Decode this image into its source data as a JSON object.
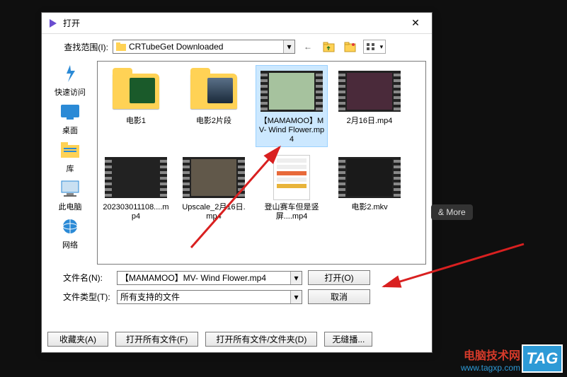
{
  "dialog": {
    "title": "打开",
    "lookup_label": "查找范围(I):",
    "lookup_value": "CRTubeGet Downloaded",
    "close_symbol": "✕"
  },
  "toolbar_icons": {
    "back": "←",
    "up": "folder-up",
    "new": "folder-new",
    "view": "view-menu",
    "view_arrow": "▾"
  },
  "places": [
    {
      "key": "quick",
      "label": "快速访问"
    },
    {
      "key": "desktop",
      "label": "桌面"
    },
    {
      "key": "library",
      "label": "库"
    },
    {
      "key": "pc",
      "label": "此电脑"
    },
    {
      "key": "network",
      "label": "网络"
    }
  ],
  "files": [
    {
      "type": "folder",
      "name": "电影1",
      "inset": "green"
    },
    {
      "type": "folder",
      "name": "电影2片段",
      "inset": "landscape"
    },
    {
      "type": "video",
      "name": "【MAMAMOO】MV- Wind Flower.mp4",
      "selected": true,
      "tint": "#a6c29e"
    },
    {
      "type": "video",
      "name": "2月16日.mp4",
      "tint": "#4a2a3a"
    },
    {
      "type": "video",
      "name": "202303011108....mp4",
      "tint": "#222"
    },
    {
      "type": "video",
      "name": "Upscale_2月16日.mp4",
      "tint": "#61584a"
    },
    {
      "type": "app",
      "name": "登山赛车但是竖屏....mp4"
    },
    {
      "type": "video",
      "name": "电影2.mkv",
      "tint": "#1a1a1a"
    }
  ],
  "bottom": {
    "name_label": "文件名(N):",
    "name_value": "【MAMAMOO】MV- Wind Flower.mp4",
    "type_label": "文件类型(T):",
    "type_value": "所有支持的文件",
    "open_btn": "打开(O)",
    "cancel_btn": "取消"
  },
  "footer": {
    "fav": "收藏夹(A)",
    "open_all_files": "打开所有文件(F)",
    "open_all_folders": "打开所有文件/文件夹(D)",
    "seamless": "无缝播..."
  },
  "external": {
    "more": "& More",
    "wm_badge": "TAG",
    "wm_line1": "电脑技术网",
    "wm_line2": "www.tagxp.com"
  }
}
